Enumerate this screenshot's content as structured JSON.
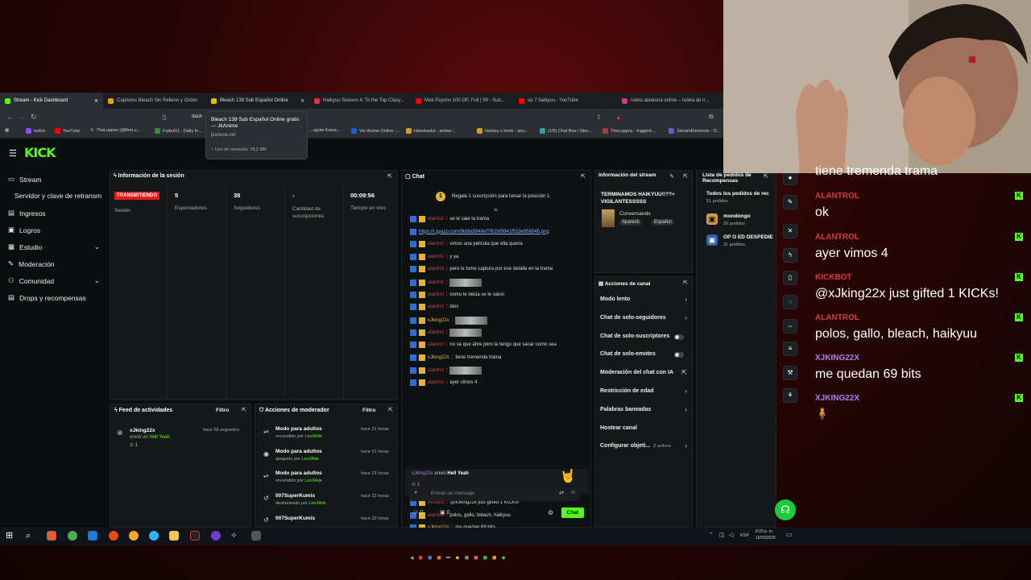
{
  "tabs": [
    {
      "label": "Stream - Kick Dashboard",
      "active": true
    },
    {
      "label": "Capitulos Bleach Sin Relleno y Orden"
    },
    {
      "label": "Bleach 139 Sub Español Online",
      "active": false
    },
    {
      "label": "Haikyuu Season 4: To the Top Clasy..."
    },
    {
      "label": "Mob Psycho 100 OP, Full | 99 - Sub..."
    },
    {
      "label": "op 7 haikyuu - YouTube"
    },
    {
      "label": "ruleta aleatoria online – ruleta de n..."
    }
  ],
  "url": "dash",
  "bookmarks": [
    "twitch",
    "YouTube",
    "TheLuppos (@theLu...",
    "Futbol11 - Daily fo...",
    "...ugote Kawa...",
    "Ver Anime Online -...",
    "Hanebadol - anime...",
    "Hantsu x Iresh - anu...",
    "(1/5) Chat Box / Stre...",
    "TheLuppos - Inggerit...",
    "StreamElements - O..."
  ],
  "tooltip": {
    "title": "Bleach 139 Sub Español Online gratis — JkAnime",
    "domain": "jkanime.net",
    "memory": "Uso de memoria: 78,2 MB"
  },
  "logo": "KICK",
  "sidebar": {
    "items": [
      {
        "label": "Stream"
      },
      {
        "label": "Servidor y clave de retransm"
      },
      {
        "label": "Ingresos"
      },
      {
        "label": "Logros"
      },
      {
        "label": "Estudio"
      },
      {
        "label": "Moderación"
      },
      {
        "label": "Comunidad"
      },
      {
        "label": "Drops y recompensas"
      }
    ]
  },
  "session": {
    "title": "Información de la sesión",
    "live_badge": "TRANSMITIENDO",
    "session_label": "Sesión",
    "stats": [
      {
        "value": "5",
        "label": "Espectadores"
      },
      {
        "value": "38",
        "label": "Seguidores"
      },
      {
        "value": "-",
        "label": "Cantidad de suscripciones"
      },
      {
        "value": "00:09:56",
        "label": "Tiempo en vivo"
      }
    ]
  },
  "activity": {
    "title": "Feed de actividades",
    "filter": "Filtro",
    "item": {
      "user": "xJking22x",
      "time": "hace 58 segundos",
      "action": "envió un",
      "gift": "Hell Yeah",
      "count": "1"
    }
  },
  "modactions": {
    "title": "Acciones de moderador",
    "filter": "Filtro",
    "items": [
      {
        "title": "Modo para adultos",
        "time": "hace 21 horas",
        "sub": "encendido por",
        "by": "Leo34de"
      },
      {
        "title": "Modo para adultos",
        "time": "hace 21 horas",
        "sub": "apagado por",
        "by": "Leo34de"
      },
      {
        "title": "Modo para adultos",
        "time": "hace 21 horas",
        "sub": "encendido por",
        "by": "Leo34de"
      },
      {
        "title": "007SuperKumis",
        "time": "hace 22 horas",
        "sub": "desbaneado por",
        "by": "Leo34de"
      },
      {
        "title": "007SuperKumis",
        "time": "hace 22 horas",
        "sub": "",
        "by": ""
      }
    ]
  },
  "chat": {
    "title": "Chat",
    "pinned": "Regala 1 suscripción para tomar la posición 1",
    "pinned_rank": "1",
    "lines": [
      {
        "user": "alantrol",
        "text": "se le saie la trama",
        "color": "r"
      },
      {
        "user": "",
        "text": "https://i.gyazo.com/9bbfa5948ef7f62bf9841f533e956845.png",
        "color": "link"
      },
      {
        "user": "alantrol",
        "text": "vimos una pelicula que ella queria",
        "color": "r"
      },
      {
        "user": "alantrol",
        "text": "y ya",
        "color": "r"
      },
      {
        "user": "alantrol",
        "text": "pero le tome captura por ese detalle en la trama",
        "color": "r"
      },
      {
        "user": "alantrol",
        "text": "",
        "color": "r",
        "img": true
      },
      {
        "user": "alantrol",
        "text": "como te decia se le salon",
        "color": "r"
      },
      {
        "user": "alantrol",
        "text": "dios",
        "color": "r"
      },
      {
        "user": "xJking22x",
        "text": "",
        "color": "y",
        "img": true
      },
      {
        "user": "alantrol",
        "text": "",
        "color": "r",
        "img": true
      },
      {
        "user": "alantrol",
        "text": "no se que ahre pero la tengo que sacar como sea",
        "color": "r"
      },
      {
        "user": "xJking22x",
        "text": "tiene tremenda trama",
        "color": "y"
      },
      {
        "user": "alantrol",
        "text": "",
        "color": "r",
        "img": true
      },
      {
        "user": "alantrol",
        "text": "ayer vimos 4",
        "color": "r"
      }
    ],
    "gift": {
      "user": "xJking22x",
      "text": "envió",
      "item": "Hell Yeah",
      "count": "1"
    },
    "lines2": [
      {
        "user": "KickBot",
        "text": "@xJking22x just gifted 1 KICKs!",
        "color": "r"
      },
      {
        "user": "alantrol",
        "text": "polos, gallo, bleach, haikyuu",
        "color": "r"
      },
      {
        "user": "xJking22x",
        "text": "me quedan 69 bits",
        "color": "y"
      },
      {
        "user": "xJking22x",
        "text": "",
        "color": "y",
        "img": true
      }
    ],
    "input_placeholder": "Enviar un mensaje",
    "viewers": "0",
    "points": "0",
    "send": "Chat"
  },
  "streaminfo": {
    "title": "Información del stream",
    "stream_title": "TERMINAMOS HAIKYUU!!??+ VIGILANTESSSSS",
    "category": "Conversando",
    "tags": [
      "Spanish",
      "Español"
    ]
  },
  "channelactions": {
    "title": "Acciones de canal",
    "items": [
      {
        "label": "Modo lento",
        "kind": "arrow"
      },
      {
        "label": "Chat de solo-seguidores",
        "kind": "arrow"
      },
      {
        "label": "Chat de solo-suscriptores",
        "kind": "toggle"
      },
      {
        "label": "Chat de solo-emotes",
        "kind": "toggle"
      },
      {
        "label": "Moderación del chat con IA",
        "kind": "ext"
      },
      {
        "label": "Restricción de edad",
        "kind": "arrow"
      },
      {
        "label": "Palabras baneadas",
        "kind": "arrow"
      },
      {
        "label": "Hostear canal",
        "kind": "none"
      },
      {
        "label": "Configurar objeti...",
        "kind": "arrow",
        "extra": "2 activos"
      }
    ]
  },
  "rewards": {
    "title": "Lista de pedidos de Recompensas",
    "all": "Todos los pedidos de rec",
    "all_count": "51 pedidos",
    "items": [
      {
        "name": "mondongo",
        "count": "20 pedidos"
      },
      {
        "name": "OP O ED DESPEDIE",
        "count": "31 pedidos"
      }
    ]
  },
  "overlay": {
    "top_text": "tiene tremenda trama",
    "messages": [
      {
        "name": "ALANTROL",
        "text": "ok"
      },
      {
        "name": "ALANTROL",
        "text": "ayer vimos 4"
      },
      {
        "name": "KICKBOT",
        "text": "@xJking22x just gifted 1 KICKs!"
      },
      {
        "name": "ALANTROL",
        "text": "polos, gallo, bleach, haikyuu"
      },
      {
        "name": "XJKING22X",
        "text": "me quedan 69 bits"
      },
      {
        "name": "XJKING22X",
        "text": ""
      }
    ],
    "kick_badge": "K"
  },
  "taskbar": {
    "lang": "ESP",
    "time": "8:20 p. m.",
    "date": "16/03/2026"
  },
  "colors": {
    "kick_green": "#53fc18",
    "live_red": "#e91916"
  }
}
